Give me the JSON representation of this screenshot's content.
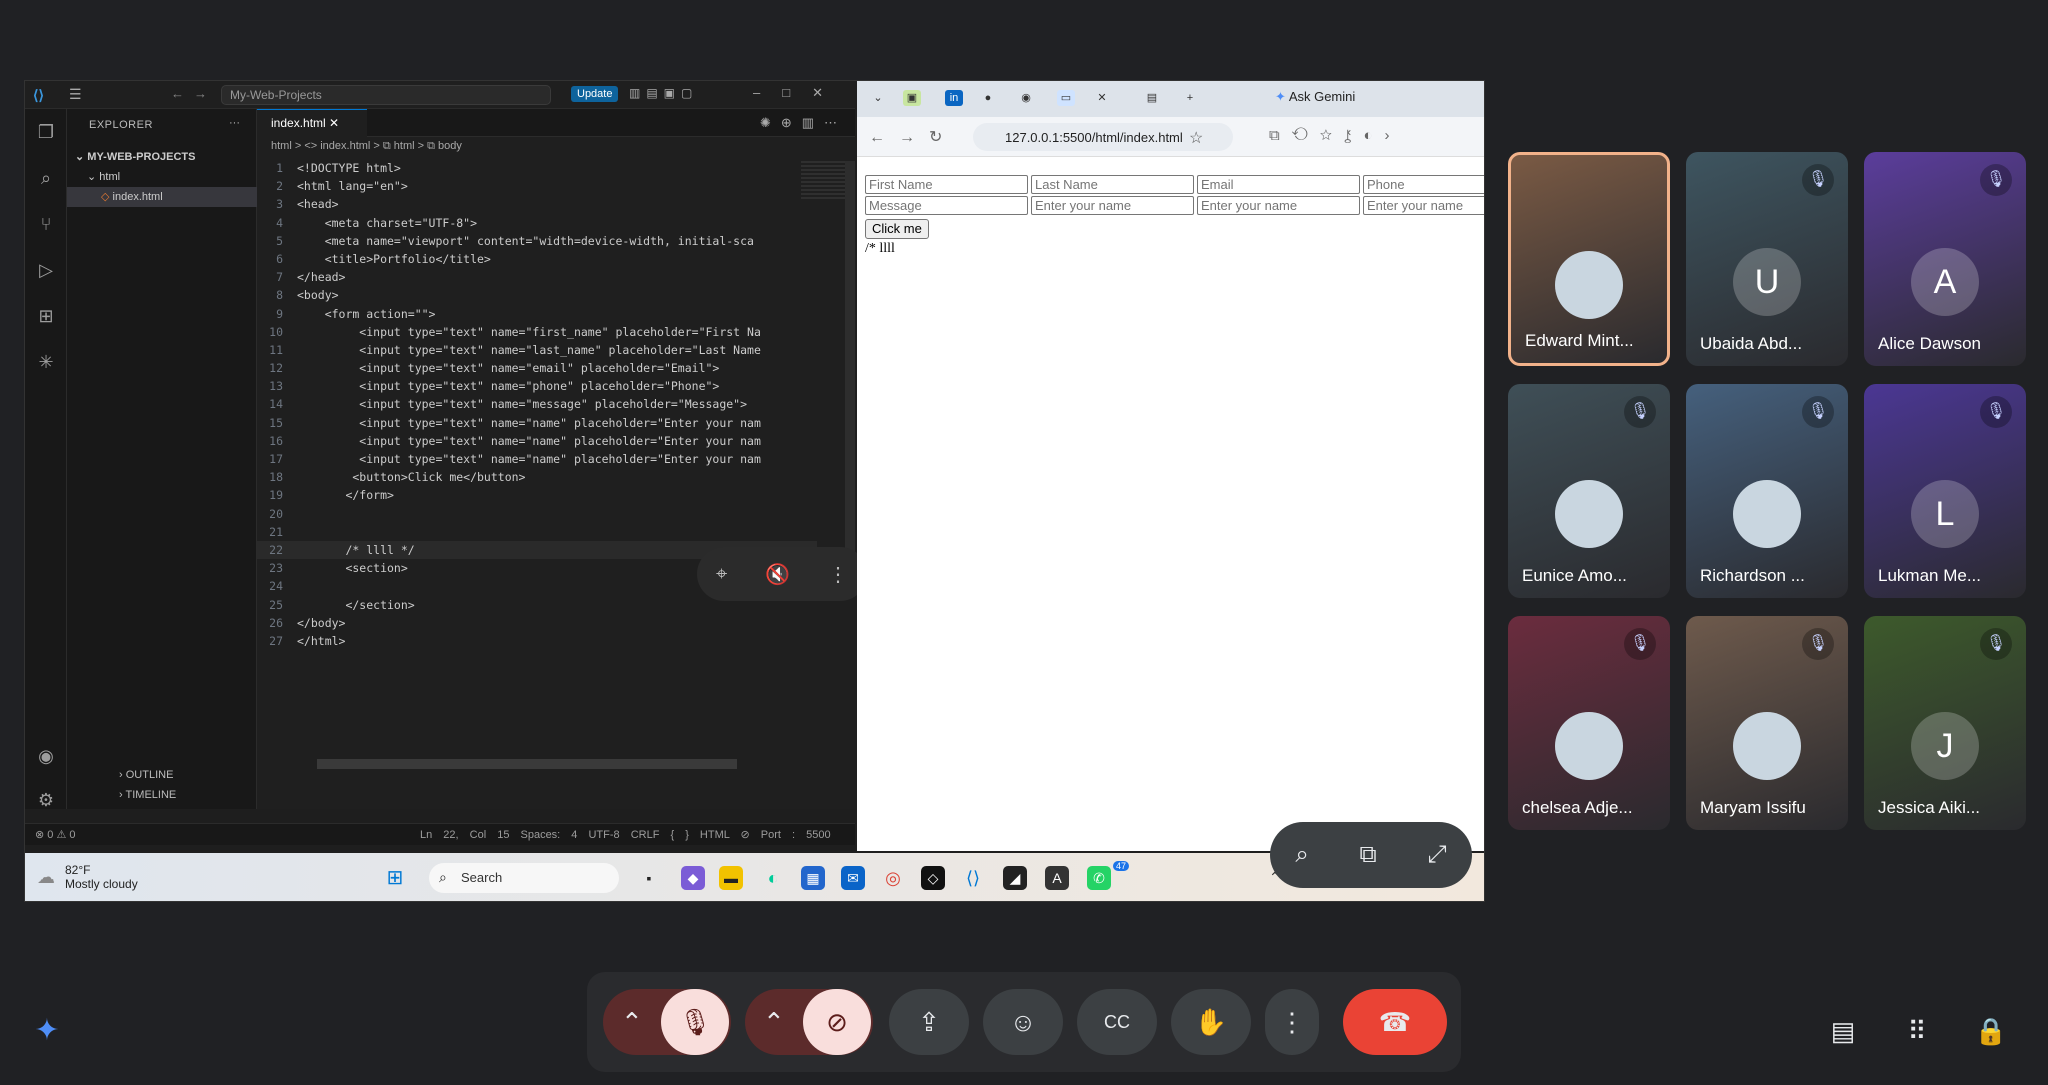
{
  "vscode": {
    "project": "My-Web-Projects",
    "update": "Update",
    "explorer": "EXPLORER",
    "folder_root": "MY-WEB-PROJECTS",
    "folder": "html",
    "file": "index.html",
    "tab": "index.html",
    "breadcrumb": "html  >  <> index.html  >  ⧉ html  >  ⧉ body",
    "outline": "OUTLINE",
    "timeline": "TIMELINE",
    "code": [
      "<!DOCTYPE html>",
      "<html lang=\"en\">",
      "<head>",
      "    <meta charset=\"UTF-8\">",
      "    <meta name=\"viewport\" content=\"width=device-width, initial-sca",
      "    <title>Portfolio</title>",
      "</head>",
      "<body>",
      "    <form action=\"\">",
      "         <input type=\"text\" name=\"first_name\" placeholder=\"First Na",
      "         <input type=\"text\" name=\"last_name\" placeholder=\"Last Name",
      "         <input type=\"text\" name=\"email\" placeholder=\"Email\">",
      "         <input type=\"text\" name=\"phone\" placeholder=\"Phone\">",
      "         <input type=\"text\" name=\"message\" placeholder=\"Message\">",
      "         <input type=\"text\" name=\"name\" placeholder=\"Enter your nam",
      "         <input type=\"text\" name=\"name\" placeholder=\"Enter your nam",
      "         <input type=\"text\" name=\"name\" placeholder=\"Enter your nam",
      "        <button>Click me</button>",
      "       </form>",
      "",
      "",
      "       /* llll */",
      "       <section>",
      "",
      "       </section>",
      "</body>",
      "</html>"
    ],
    "status_errors": "⊗ 0 ⚠ 0",
    "status_right": "Ln 22, Col 15   Spaces: 4   UTF-8   CRLF   { } HTML   ⊘ Port : 5500"
  },
  "browser": {
    "url": "127.0.0.1:5500/html/index.html",
    "ask": "Ask Gemini",
    "placeholders_row1": [
      "First Name",
      "Last Name",
      "Email",
      "Phone"
    ],
    "placeholders_row2": [
      "Message",
      "Enter your name",
      "Enter your name",
      "Enter your name"
    ],
    "button": "Click me",
    "text": "/* llll"
  },
  "taskbar": {
    "temp": "82°F",
    "weather": "Mostly cloudy",
    "search": "Search",
    "badge": "47"
  },
  "participants": [
    {
      "name": "Edward Mint...",
      "initial": "",
      "color": "#7a5a44"
    },
    {
      "name": "Ubaida Abd...",
      "initial": "U",
      "color": "#3e5560"
    },
    {
      "name": "Alice Dawson",
      "initial": "A",
      "color": "#5b3d9c"
    },
    {
      "name": "Eunice Amo...",
      "initial": "",
      "color": "#3f4f57"
    },
    {
      "name": "Richardson ...",
      "initial": "",
      "color": "#45607d"
    },
    {
      "name": "Lukman Me...",
      "initial": "L",
      "color": "#4b3794"
    },
    {
      "name": "chelsea Adje...",
      "initial": "",
      "color": "#6b2c3e"
    },
    {
      "name": "Maryam Issifu",
      "initial": "",
      "color": "#6e5a4c"
    },
    {
      "name": "Jessica Aiki...",
      "initial": "J",
      "color": "#3d5a2c"
    }
  ],
  "colors": {
    "accent": "#0e639c",
    "hangup": "#ea4335",
    "active_speaker": "#f2b28a"
  }
}
